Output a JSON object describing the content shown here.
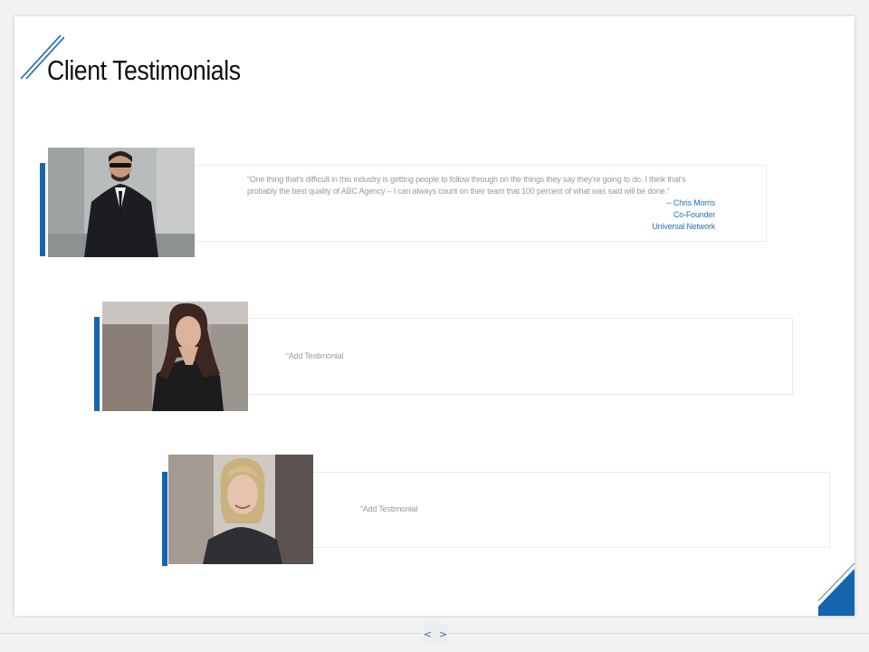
{
  "slide": {
    "title": "Client Testimonials",
    "accent_color": "#1565b0"
  },
  "testimonials": [
    {
      "quote_line1": "“One thing that’s difficult in this industry is getting people to follow through on the things they say they’re going to do. I think that’s",
      "quote_line2": "probably the best quality of ABC Agency – I can always count on their team that 100 percent of what was said will be done.”",
      "name": "--   Chris Morris",
      "role": "Co-Founder",
      "company": "Universal Network",
      "photo_icon": "man-in-suit-photo"
    },
    {
      "placeholder": "“Add Testimonial",
      "photo_icon": "woman-dark-hair-photo"
    },
    {
      "placeholder": "“Add Testimonial",
      "photo_icon": "woman-blonde-photo"
    }
  ],
  "navigation": {
    "prev_icon": "chevron-left-icon",
    "next_icon": "chevron-right-icon",
    "prev_label": "<",
    "next_label": ">"
  }
}
